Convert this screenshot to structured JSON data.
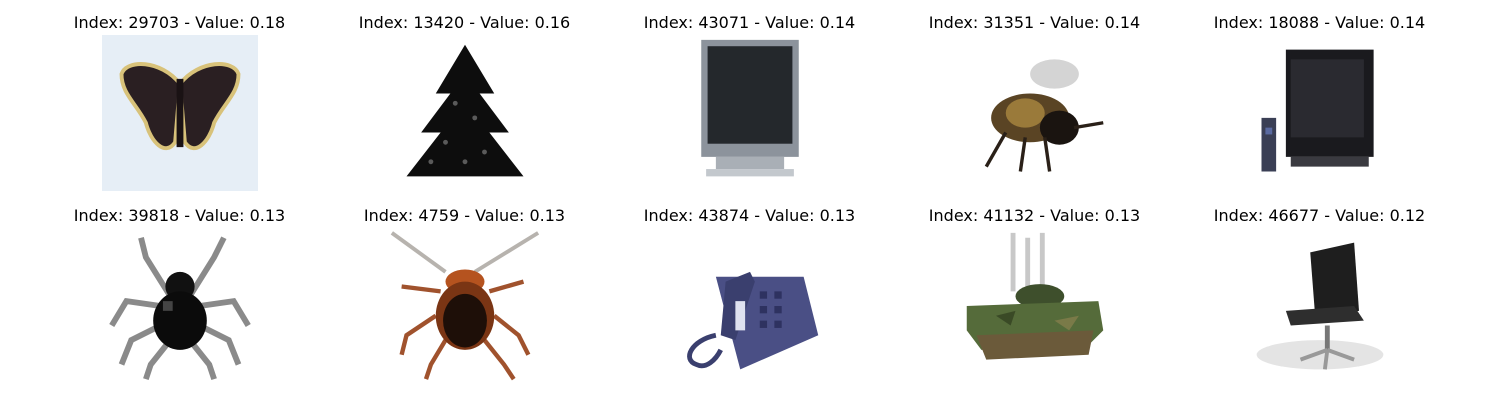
{
  "grid": {
    "items": [
      {
        "index": 29703,
        "value": 0.18,
        "title": "Index: 29703 - Value: 0.18",
        "subject": "butterfly"
      },
      {
        "index": 13420,
        "value": 0.16,
        "title": "Index: 13420 - Value: 0.16",
        "subject": "pine-tree"
      },
      {
        "index": 43071,
        "value": 0.14,
        "title": "Index: 43071 - Value: 0.14",
        "subject": "television"
      },
      {
        "index": 31351,
        "value": 0.14,
        "title": "Index: 31351 - Value: 0.14",
        "subject": "bee"
      },
      {
        "index": 18088,
        "value": 0.14,
        "title": "Index: 18088 - Value: 0.14",
        "subject": "television-with-remote"
      },
      {
        "index": 39818,
        "value": 0.13,
        "title": "Index: 39818 - Value: 0.13",
        "subject": "spider"
      },
      {
        "index": 4759,
        "value": 0.13,
        "title": "Index: 4759 - Value: 0.13",
        "subject": "cockroach"
      },
      {
        "index": 43874,
        "value": 0.13,
        "title": "Index: 43874 - Value: 0.13",
        "subject": "telephone"
      },
      {
        "index": 41132,
        "value": 0.13,
        "title": "Index: 41132 - Value: 0.13",
        "subject": "tank"
      },
      {
        "index": 46677,
        "value": 0.12,
        "title": "Index: 46677 - Value: 0.12",
        "subject": "office-chair"
      }
    ]
  }
}
